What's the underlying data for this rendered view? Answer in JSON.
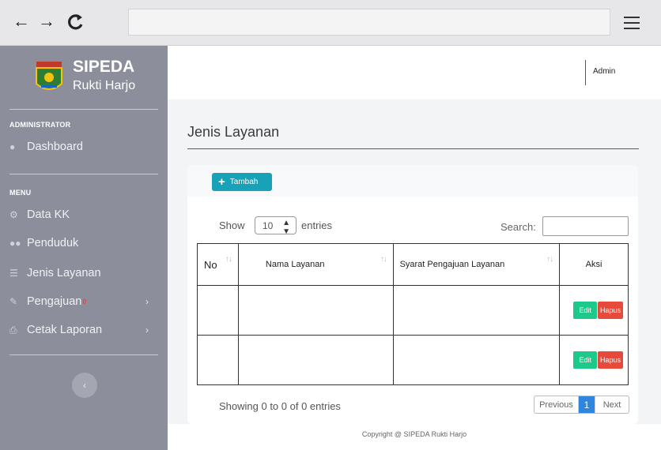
{
  "browser": {
    "back_glyph": "←",
    "forward_glyph": "→",
    "reload_glyph": "↻"
  },
  "sidebar": {
    "brand_title": "SIPEDA",
    "brand_subtitle": "Rukti Harjo",
    "sections": [
      {
        "label": "ADMINISTRATOR",
        "items": [
          {
            "label": "Dashboard",
            "icon": "palette-icon"
          }
        ]
      },
      {
        "label": "MENU",
        "items": [
          {
            "label": "Data KK",
            "icon": "gear-icon"
          },
          {
            "label": "Penduduk",
            "icon": "users-icon"
          },
          {
            "label": "Jenis Layanan",
            "icon": "list-icon"
          },
          {
            "label": "Pengajuan",
            "icon": "edit-icon",
            "badge": "0"
          },
          {
            "label": "Cetak Laporan",
            "icon": "print-icon"
          }
        ]
      }
    ]
  },
  "topbar": {
    "user": "Admin"
  },
  "page": {
    "title": "Jenis Layanan"
  },
  "toolbar": {
    "add_label": "Tambah"
  },
  "datatable": {
    "show_label": "Show",
    "entries_value": "10",
    "entries_label": "entries",
    "search_label": "Search:",
    "columns": [
      "No",
      "Nama Layanan",
      "Syarat Pengajuan Layanan",
      "Aksi"
    ],
    "rows": [
      {
        "no": "",
        "nama": "",
        "syarat": "",
        "edit": "Edit",
        "hapus": "Hapus"
      },
      {
        "no": "",
        "nama": "",
        "syarat": "",
        "edit": "Edit",
        "hapus": "Hapus"
      }
    ],
    "info": "Showing 0 to 0 of 0 entries",
    "pagination": {
      "previous": "Previous",
      "current": "1",
      "next": "Next"
    }
  },
  "footer": {
    "copyright": "Copyright @ SIPEDA Rukti Harjo"
  },
  "colors": {
    "sidebar_bg": "#8c8f9b",
    "add_button": "#17a2b8",
    "edit_button": "#1cc88a",
    "delete_button": "#e74a3b",
    "page_active": "#2e86de",
    "badge": "#e74c3c"
  }
}
